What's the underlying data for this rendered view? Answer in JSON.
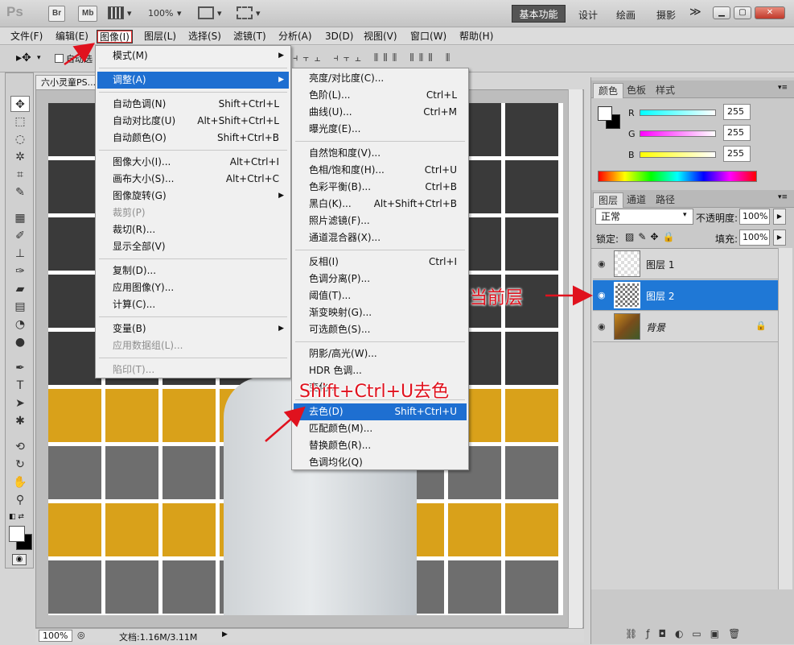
{
  "titlebar": {
    "logo": "Ps",
    "bridge": "Br",
    "minibridge": "Mb",
    "zoom": "100%",
    "workspaces": [
      "基本功能",
      "设计",
      "绘画",
      "摄影"
    ],
    "more": "≫"
  },
  "menubar": [
    "文件(F)",
    "编辑(E)",
    "图像(I)",
    "图层(L)",
    "选择(S)",
    "滤镜(T)",
    "分析(A)",
    "3D(D)",
    "视图(V)",
    "窗口(W)",
    "帮助(H)"
  ],
  "optbar": {
    "label": "自动选"
  },
  "doc": {
    "tab": "六小灵童PS...",
    "zoom": "100%",
    "info": "文档:1.16M/3.11M"
  },
  "image_menu": {
    "items": [
      {
        "label": "模式(M)",
        "key": "",
        "sub": true
      },
      {
        "sep": true
      },
      {
        "label": "调整(A)",
        "key": "",
        "sub": true,
        "hi": true
      },
      {
        "sep": true
      },
      {
        "label": "自动色调(N)",
        "key": "Shift+Ctrl+L"
      },
      {
        "label": "自动对比度(U)",
        "key": "Alt+Shift+Ctrl+L"
      },
      {
        "label": "自动颜色(O)",
        "key": "Shift+Ctrl+B"
      },
      {
        "sep": true
      },
      {
        "label": "图像大小(I)...",
        "key": "Alt+Ctrl+I"
      },
      {
        "label": "画布大小(S)...",
        "key": "Alt+Ctrl+C"
      },
      {
        "label": "图像旋转(G)",
        "key": "",
        "sub": true
      },
      {
        "label": "裁剪(P)",
        "key": "",
        "dis": true
      },
      {
        "label": "裁切(R)...",
        "key": ""
      },
      {
        "label": "显示全部(V)",
        "key": ""
      },
      {
        "sep": true
      },
      {
        "label": "复制(D)...",
        "key": ""
      },
      {
        "label": "应用图像(Y)...",
        "key": ""
      },
      {
        "label": "计算(C)...",
        "key": ""
      },
      {
        "sep": true
      },
      {
        "label": "变量(B)",
        "key": "",
        "sub": true
      },
      {
        "label": "应用数据组(L)...",
        "key": "",
        "dis": true
      },
      {
        "sep": true
      },
      {
        "label": "陷印(T)...",
        "key": "",
        "dis": true
      }
    ]
  },
  "adjust_menu": {
    "items": [
      {
        "label": "亮度/对比度(C)...",
        "key": ""
      },
      {
        "label": "色阶(L)...",
        "key": "Ctrl+L"
      },
      {
        "label": "曲线(U)...",
        "key": "Ctrl+M"
      },
      {
        "label": "曝光度(E)...",
        "key": ""
      },
      {
        "sep": true
      },
      {
        "label": "自然饱和度(V)...",
        "key": ""
      },
      {
        "label": "色相/饱和度(H)...",
        "key": "Ctrl+U"
      },
      {
        "label": "色彩平衡(B)...",
        "key": "Ctrl+B"
      },
      {
        "label": "黑白(K)...",
        "key": "Alt+Shift+Ctrl+B"
      },
      {
        "label": "照片滤镜(F)...",
        "key": ""
      },
      {
        "label": "通道混合器(X)...",
        "key": ""
      },
      {
        "sep": true
      },
      {
        "label": "反相(I)",
        "key": "Ctrl+I"
      },
      {
        "label": "色调分离(P)...",
        "key": ""
      },
      {
        "label": "阈值(T)...",
        "key": ""
      },
      {
        "label": "渐变映射(G)...",
        "key": ""
      },
      {
        "label": "可选颜色(S)...",
        "key": ""
      },
      {
        "sep": true
      },
      {
        "label": "阴影/高光(W)...",
        "key": ""
      },
      {
        "label": "HDR 色调...",
        "key": ""
      },
      {
        "label": "变化...",
        "key": ""
      },
      {
        "sep": true
      },
      {
        "label": "去色(D)",
        "key": "Shift+Ctrl+U",
        "hi": true
      },
      {
        "label": "匹配颜色(M)...",
        "key": ""
      },
      {
        "label": "替换颜色(R)...",
        "key": ""
      },
      {
        "label": "色调均化(Q)",
        "key": ""
      }
    ]
  },
  "color_panel": {
    "tabs": [
      "颜色",
      "色板",
      "样式"
    ],
    "channels": [
      {
        "name": "R",
        "value": "255"
      },
      {
        "name": "G",
        "value": "255"
      },
      {
        "name": "B",
        "value": "255"
      }
    ]
  },
  "layers_panel": {
    "tabs": [
      "图层",
      "通道",
      "路径"
    ],
    "blend": "正常",
    "opacity_label": "不透明度:",
    "opacity": "100%",
    "lock_label": "锁定:",
    "fill_label": "填充:",
    "fill": "100%",
    "layers": [
      {
        "name": "图层 1",
        "active": false
      },
      {
        "name": "图层 2",
        "active": true
      },
      {
        "name": "背景",
        "active": false,
        "locked": true
      }
    ]
  },
  "annotations": {
    "current_layer": "当前层",
    "shortcut": "Shift+Ctrl+U去色"
  },
  "colors": {
    "accent": "#1e6fd1",
    "annotation": "#e0121e",
    "yellow": "#d9a11a",
    "gray": "#6e6e6e"
  }
}
